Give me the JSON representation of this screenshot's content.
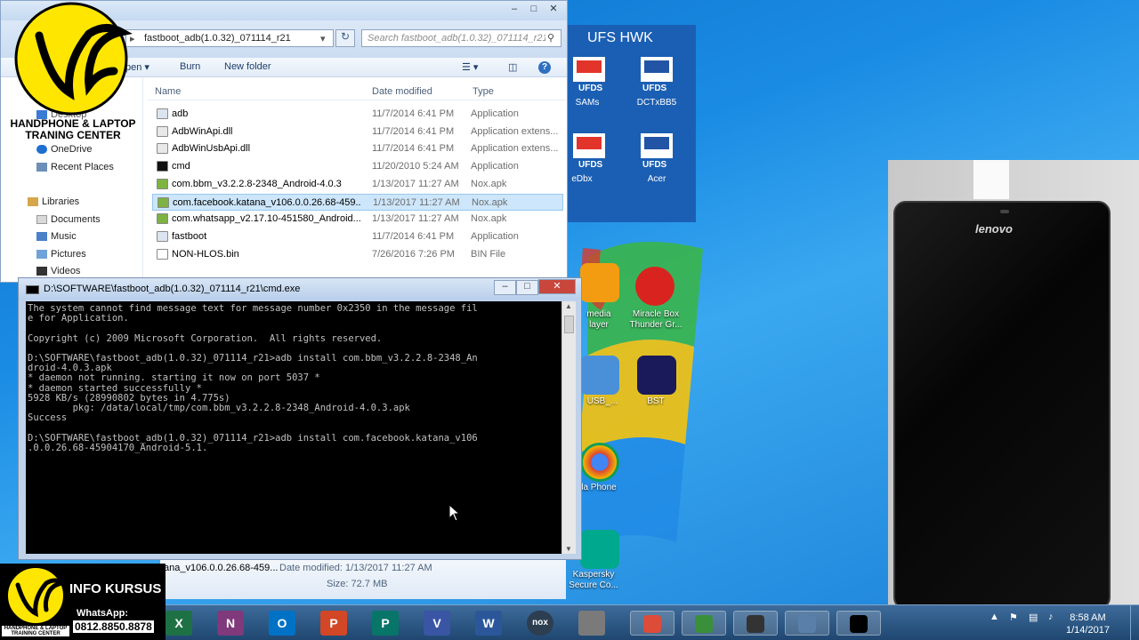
{
  "explorer": {
    "address_path": "fastboot_adb(1.0.32)_071114_r21",
    "search_placeholder": "Search fastboot_adb(1.0.32)_071114_r21",
    "toolbar": {
      "open": "pen",
      "burn": "Burn",
      "new_folder": "New folder"
    },
    "nav": [
      "Desktop",
      "OneDrive",
      "Recent Places",
      "Libraries",
      "Documents",
      "Music",
      "Pictures",
      "Videos"
    ],
    "columns": {
      "name": "Name",
      "date": "Date modified",
      "type": "Type"
    },
    "files": [
      {
        "name": "adb",
        "date": "11/7/2014 6:41 PM",
        "type": "Application",
        "icon": "exe-icon"
      },
      {
        "name": "AdbWinApi.dll",
        "date": "11/7/2014 6:41 PM",
        "type": "Application extens...",
        "icon": "dll-icon"
      },
      {
        "name": "AdbWinUsbApi.dll",
        "date": "11/7/2014 6:41 PM",
        "type": "Application extens...",
        "icon": "dll-icon"
      },
      {
        "name": "cmd",
        "date": "11/20/2010 5:24 AM",
        "type": "Application",
        "icon": "cmd-icon"
      },
      {
        "name": "com.bbm_v3.2.2.8-2348_Android-4.0.3",
        "date": "1/13/2017 11:27 AM",
        "type": "Nox.apk",
        "icon": "apk-icon"
      },
      {
        "name": "com.facebook.katana_v106.0.0.26.68-459...",
        "date": "1/13/2017 11:27 AM",
        "type": "Nox.apk",
        "icon": "apk-icon",
        "selected": true
      },
      {
        "name": "com.whatsapp_v2.17.10-451580_Android...",
        "date": "1/13/2017 11:27 AM",
        "type": "Nox.apk",
        "icon": "apk-icon"
      },
      {
        "name": "fastboot",
        "date": "11/7/2014 6:41 PM",
        "type": "Application",
        "icon": "exe-icon"
      },
      {
        "name": "NON-HLOS.bin",
        "date": "7/26/2016 7:26 PM",
        "type": "BIN File",
        "icon": "file-icon"
      }
    ],
    "details": {
      "name": "ana_v106.0.0.26.68-459...",
      "date_label": "Date modified: 1/13/2017 11:27 AM",
      "size_label": "Size: 72.7 MB"
    }
  },
  "ufs": {
    "title": "UFS HWK",
    "icons": [
      "SAMs",
      "DCTxBB5",
      "eDbx",
      "Acer"
    ]
  },
  "desktop_icons": [
    {
      "label": "media\nlayer",
      "icon": "vlc-icon"
    },
    {
      "label": "Miracle Box\nThunder Gr...",
      "icon": "miracle-box-icon"
    },
    {
      "label": "USB_...",
      "icon": "usb-icon"
    },
    {
      "label": "BST",
      "icon": "bst-icon"
    },
    {
      "label": "la Phone",
      "icon": "chrome-icon"
    },
    {
      "label": "Kaspersky\nSecure Co...",
      "icon": "kaspersky-icon"
    }
  ],
  "cmd": {
    "title": "D:\\SOFTWARE\\fastboot_adb(1.0.32)_071114_r21\\cmd.exe",
    "lines": [
      "The system cannot find message text for message number 0x2350 in the message fil",
      "e for Application.",
      "",
      "Copyright (c) 2009 Microsoft Corporation.  All rights reserved.",
      "",
      "D:\\SOFTWARE\\fastboot_adb(1.0.32)_071114_r21>adb install com.bbm_v3.2.2.8-2348_An",
      "droid-4.0.3.apk",
      "* daemon not running. starting it now on port 5037 *",
      "* daemon started successfully *",
      "5928 KB/s (28990802 bytes in 4.775s)",
      "        pkg: /data/local/tmp/com.bbm_v3.2.2.8-2348_Android-4.0.3.apk",
      "Success",
      "",
      "D:\\SOFTWARE\\fastboot_adb(1.0.32)_071114_r21>adb install com.facebook.katana_v106",
      ".0.0.26.68-45904170_Android-5.1."
    ]
  },
  "phone": {
    "brand": "lenovo"
  },
  "logo": {
    "line1": "HANDPHONE & LAPTOP",
    "line2": "TRANING CENTER"
  },
  "badge": {
    "info": "INFO KURSUS",
    "whatsapp": "WhatsApp:",
    "number": "0812.8850.8878",
    "small": "HANDPHONE & LAPTOP TRAINING CENTER"
  },
  "taskbar": {
    "apps": [
      {
        "letter": "X",
        "color": "#1e7145",
        "icon": "excel-icon"
      },
      {
        "letter": "N",
        "color": "#80397b",
        "icon": "onenote-icon"
      },
      {
        "letter": "O",
        "color": "#0072c6",
        "icon": "outlook-icon"
      },
      {
        "letter": "P",
        "color": "#d24726",
        "icon": "powerpoint-icon"
      },
      {
        "letter": "P",
        "color": "#077568",
        "icon": "publisher-icon"
      },
      {
        "letter": "V",
        "color": "#3955a3",
        "icon": "visio-icon"
      },
      {
        "letter": "W",
        "color": "#2b579a",
        "icon": "word-icon"
      },
      {
        "letter": "nox",
        "color": "#2c3e50",
        "icon": "nox-icon"
      },
      {
        "letter": "",
        "color": "#7a7a7a",
        "icon": "paint-icon"
      },
      {
        "letter": "",
        "color": "#dd4b39",
        "icon": "chrome-icon"
      },
      {
        "letter": "",
        "color": "#3a8f3a",
        "icon": "ie-icon"
      },
      {
        "letter": "",
        "color": "#333333",
        "icon": "obs-icon"
      },
      {
        "letter": "",
        "color": "#5a7fa8",
        "icon": "network-icon"
      },
      {
        "letter": "",
        "color": "#000000",
        "icon": "cmd-icon"
      }
    ],
    "time": "8:58 AM",
    "date": "1/14/2017"
  }
}
